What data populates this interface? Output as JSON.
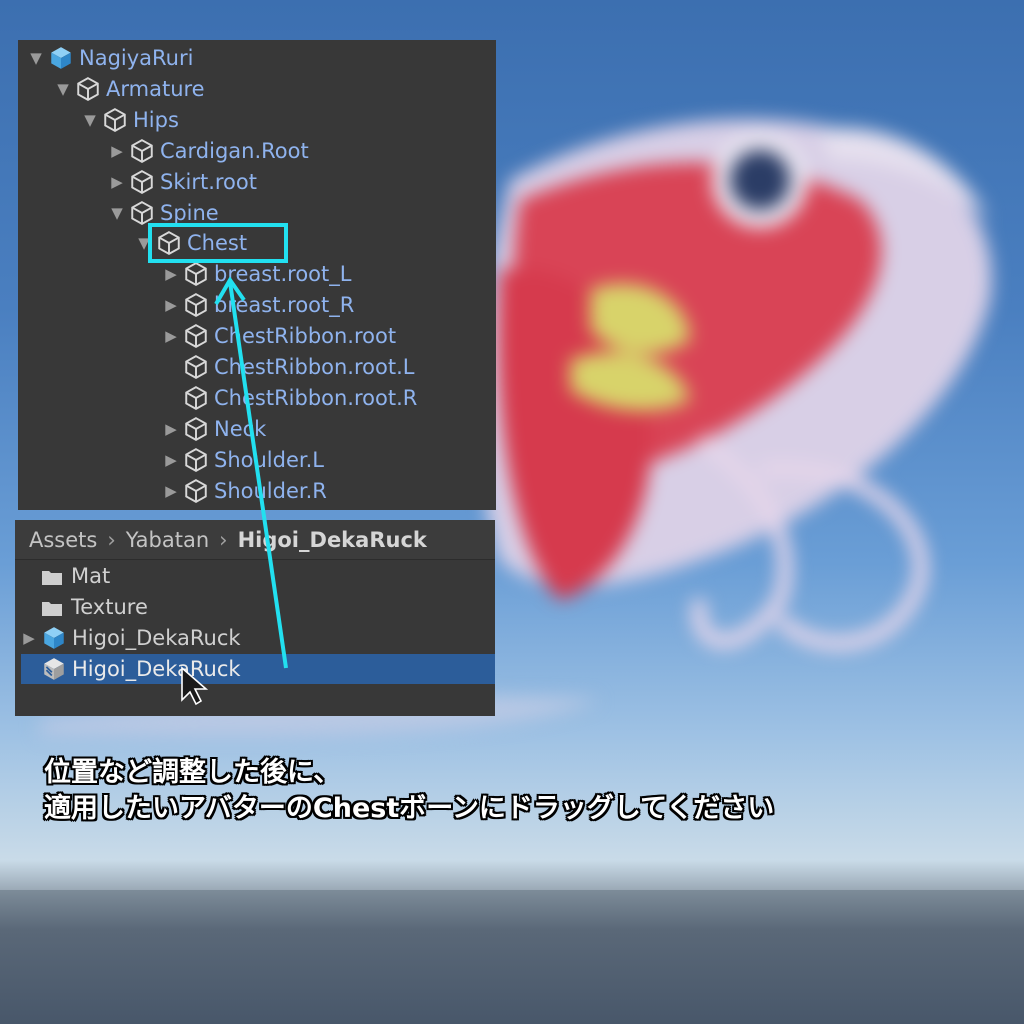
{
  "colors": {
    "panel_bg": "#383838",
    "hierarchy_text": "#8fb3ee",
    "highlight": "#22e0f0",
    "selection": "#2c5d9a"
  },
  "hierarchy": {
    "items": [
      {
        "label": "NagiyaRuri",
        "icon": "prefab-icon",
        "expanded": true,
        "depth": 0
      },
      {
        "label": "Armature",
        "icon": "gameobject-icon",
        "expanded": true,
        "depth": 1
      },
      {
        "label": "Hips",
        "icon": "gameobject-icon",
        "expanded": true,
        "depth": 2
      },
      {
        "label": "Cardigan.Root",
        "icon": "gameobject-icon",
        "expanded": false,
        "depth": 3
      },
      {
        "label": "Skirt.root",
        "icon": "gameobject-icon",
        "expanded": false,
        "depth": 3
      },
      {
        "label": "Spine",
        "icon": "gameobject-icon",
        "expanded": true,
        "depth": 3
      },
      {
        "label": "Chest",
        "icon": "gameobject-icon",
        "expanded": true,
        "depth": 4
      },
      {
        "label": "breast.root_L",
        "icon": "gameobject-icon",
        "expanded": false,
        "depth": 5
      },
      {
        "label": "breast.root_R",
        "icon": "gameobject-icon",
        "expanded": false,
        "depth": 5
      },
      {
        "label": "ChestRibbon.root",
        "icon": "gameobject-icon",
        "expanded": false,
        "depth": 5
      },
      {
        "label": "ChestRibbon.root.L",
        "icon": "gameobject-icon",
        "expanded": null,
        "depth": 5
      },
      {
        "label": "ChestRibbon.root.R",
        "icon": "gameobject-icon",
        "expanded": null,
        "depth": 5
      },
      {
        "label": "Neck",
        "icon": "gameobject-icon",
        "expanded": false,
        "depth": 5
      },
      {
        "label": "Shoulder.L",
        "icon": "gameobject-icon",
        "expanded": false,
        "depth": 5
      },
      {
        "label": "Shoulder.R",
        "icon": "gameobject-icon",
        "expanded": false,
        "depth": 5
      }
    ]
  },
  "project": {
    "breadcrumb": [
      "Assets",
      "Yabatan",
      "Higoi_DekaRuck"
    ],
    "items": [
      {
        "label": "Mat",
        "icon": "folder-icon",
        "expanded": null,
        "selected": false
      },
      {
        "label": "Texture",
        "icon": "folder-icon",
        "expanded": null,
        "selected": false
      },
      {
        "label": "Higoi_DekaRuck",
        "icon": "prefab-icon",
        "expanded": false,
        "selected": false
      },
      {
        "label": "Higoi_DekaRuck",
        "icon": "prefab-variant-icon",
        "expanded": null,
        "selected": true
      }
    ]
  },
  "caption": {
    "line1": "位置など調整した後に、",
    "line2": "適用したいアバターのChestボーンにドラッグしてください"
  }
}
